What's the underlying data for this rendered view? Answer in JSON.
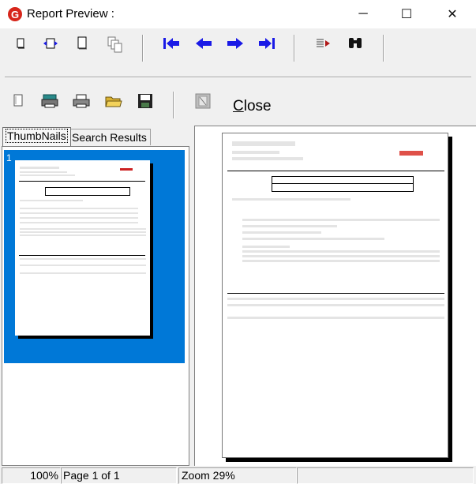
{
  "window": {
    "title": "Report Preview :",
    "minimize_symbol": "─",
    "maximize_symbol": "☐",
    "close_symbol": "✕"
  },
  "toolbar_row1": [
    "single-page-icon",
    "page-width-icon",
    "full-page-icon",
    "multi-page-icon",
    "first-page-icon",
    "previous-page-icon",
    "next-page-icon",
    "last-page-icon",
    "goto-page-icon",
    "find-binoculars-icon"
  ],
  "toolbar_row2": [
    "new-report-icon",
    "print-setup-icon",
    "print-icon",
    "open-folder-icon",
    "save-disk-icon",
    "export-icon"
  ],
  "close_button": {
    "mnemonic": "C",
    "rest": "lose"
  },
  "tabs": [
    {
      "label": "ThumbNails",
      "active": true
    },
    {
      "label": "Search Results",
      "active": false
    }
  ],
  "thumbnail": {
    "page_number": "1"
  },
  "statusbar": {
    "zoom_percent": "100%",
    "page_info": "Page 1 of 1",
    "zoom_label": "Zoom 29%"
  },
  "colors": {
    "accent": "#0078d7",
    "arrow_blue": "#1a1ae6",
    "logo_red": "#d7261b"
  }
}
